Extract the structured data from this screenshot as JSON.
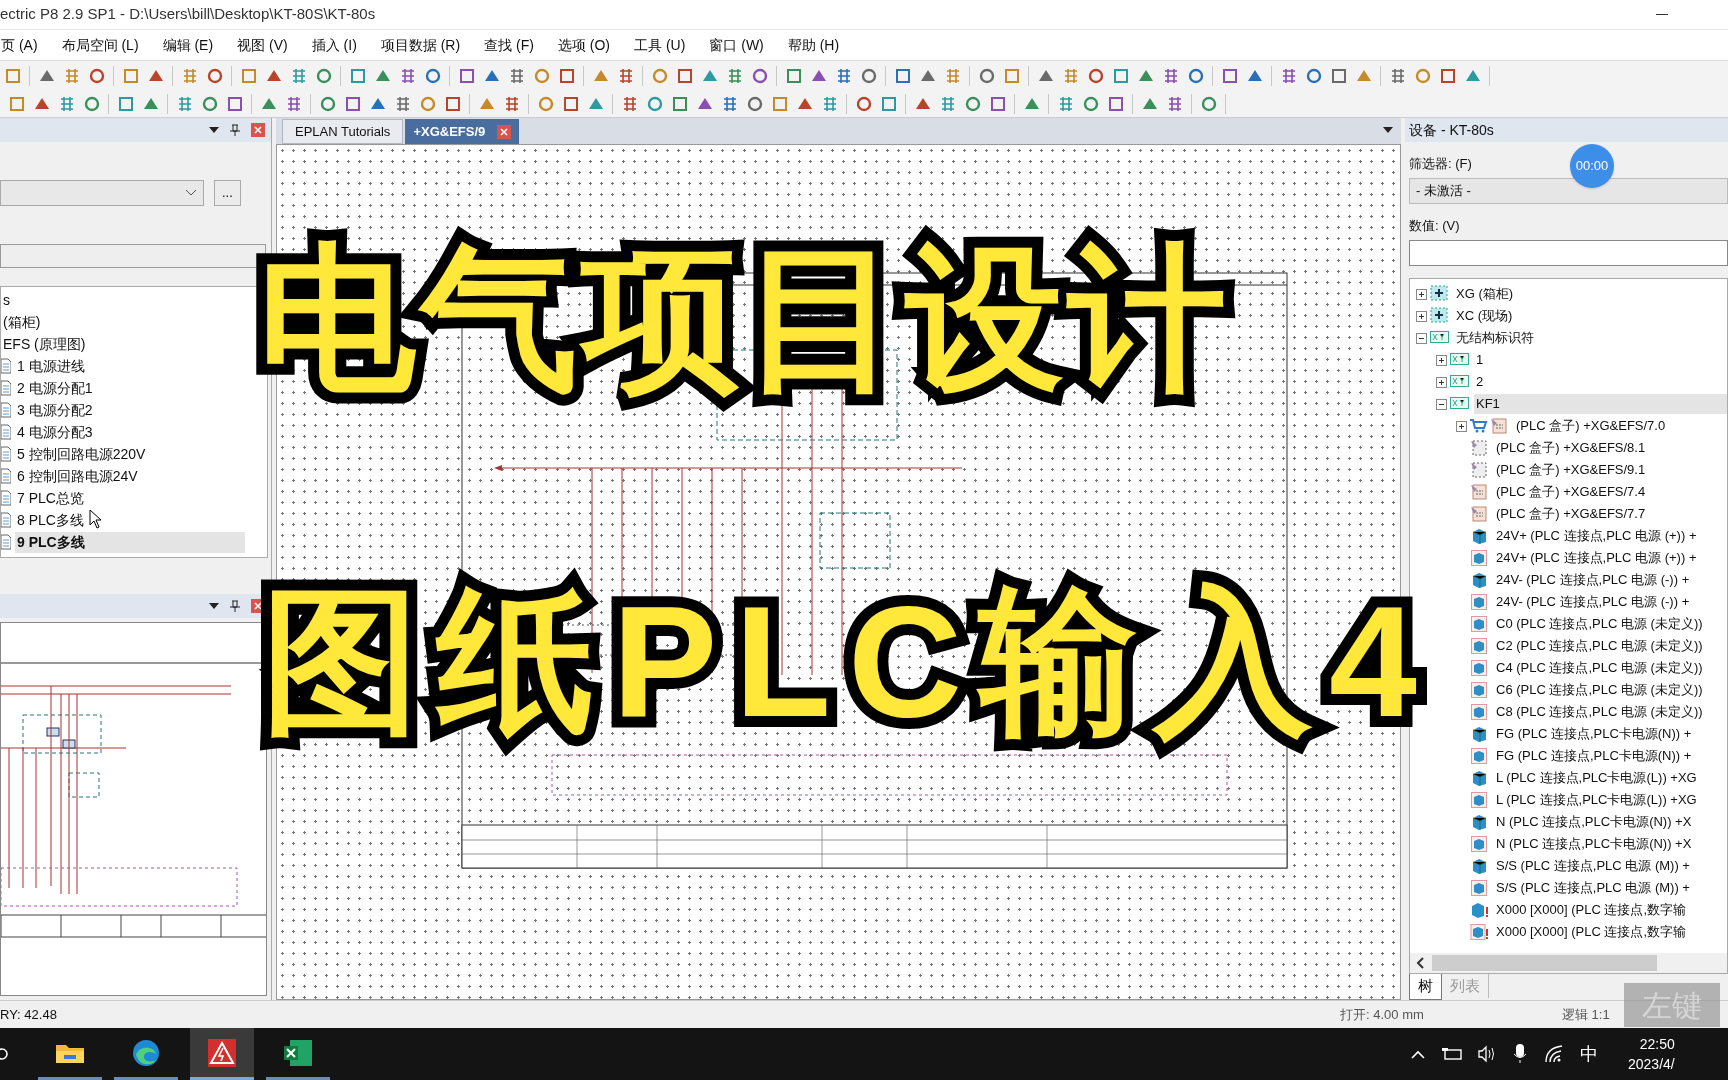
{
  "window": {
    "title": "ectric P8 2.9 SP1 - D:\\Users\\bill\\Desktop\\KT-80S\\KT-80s"
  },
  "menu": [
    "页 (A)",
    "布局空间 (L)",
    "编辑 (E)",
    "视图 (V)",
    "插入 (I)",
    "项目数据 (R)",
    "查找 (F)",
    "选项 (O)",
    "工具 (U)",
    "窗口 (W)",
    "帮助 (H)"
  ],
  "left_panel": {
    "browse_button": "...",
    "tree": [
      {
        "label": "s",
        "selected": false,
        "children": [
          {
            "label": "(箱柜)",
            "selected": false,
            "children": [
              {
                "label": "EFS (原理图)",
                "selected": false,
                "children": [
                  {
                    "label": "1 电源进线",
                    "selected": false
                  },
                  {
                    "label": "2 电源分配1",
                    "selected": false
                  },
                  {
                    "label": "3 电源分配2",
                    "selected": false
                  },
                  {
                    "label": "4 电源分配3",
                    "selected": false
                  },
                  {
                    "label": "5 控制回路电源220V",
                    "selected": false
                  },
                  {
                    "label": "6 控制回路电源24V",
                    "selected": false
                  },
                  {
                    "label": "7 PLC总览",
                    "selected": false
                  },
                  {
                    "label": "8 PLC多线",
                    "selected": false
                  },
                  {
                    "label": "9 PLC多线",
                    "selected": true
                  }
                ]
              }
            ]
          }
        ]
      }
    ]
  },
  "tabs": [
    {
      "label": "EPLAN Tutorials",
      "selected": false
    },
    {
      "label": "+XG&EFS/9",
      "selected": true
    }
  ],
  "overlay_title": [
    "电气项目设计",
    "图纸PLC输入4"
  ],
  "timer": "00:00",
  "right_panel": {
    "title": "设备 - KT-80s",
    "filter_label": "筛选器: (F)",
    "filter_value": "- 未激活 -",
    "value_label": "数值: (V)",
    "tree": [
      {
        "label": "XG (箱柜)",
        "kind": "location",
        "expanded": false,
        "selected": false
      },
      {
        "label": "XC (现场)",
        "kind": "location",
        "expanded": false,
        "selected": false
      },
      {
        "label": "无结构标识符",
        "kind": "xy",
        "expanded": true,
        "selected": false,
        "children": [
          {
            "label": "1",
            "kind": "xy",
            "expanded": false,
            "selected": false
          },
          {
            "label": "2",
            "kind": "xy",
            "expanded": false,
            "selected": false
          },
          {
            "label": "KF1",
            "kind": "xy",
            "expanded": true,
            "selected": true,
            "children": [
              {
                "label": "(PLC 盒子) +XG&EFS/7.0",
                "kind": "plc-box",
                "expanded": false,
                "selected": false
              },
              {
                "label": "(PLC 盒子) +XG&EFS/8.1",
                "kind": "plc-box-dashed",
                "selected": false
              },
              {
                "label": "(PLC 盒子) +XG&EFS/9.1",
                "kind": "plc-box-dashed",
                "selected": false
              },
              {
                "label": "(PLC 盒子) +XG&EFS/7.4",
                "kind": "plc-box",
                "selected": false
              },
              {
                "label": "(PLC 盒子) +XG&EFS/7.7",
                "kind": "plc-box",
                "selected": false
              },
              {
                "label": "24V+ (PLC 连接点,PLC 电源 (+)) +",
                "kind": "point",
                "selected": false
              },
              {
                "label": "24V+ (PLC 连接点,PLC 电源 (+)) +",
                "kind": "point-framed",
                "selected": false
              },
              {
                "label": "24V- (PLC 连接点,PLC 电源 (-)) +",
                "kind": "point",
                "selected": false
              },
              {
                "label": "24V- (PLC 连接点,PLC 电源 (-)) +",
                "kind": "point-framed",
                "selected": false
              },
              {
                "label": "C0 (PLC 连接点,PLC 电源 (未定义))",
                "kind": "point-framed",
                "selected": false
              },
              {
                "label": "C2 (PLC 连接点,PLC 电源 (未定义))",
                "kind": "point-framed",
                "selected": false
              },
              {
                "label": "C4 (PLC 连接点,PLC 电源 (未定义))",
                "kind": "point-framed",
                "selected": false
              },
              {
                "label": "C6 (PLC 连接点,PLC 电源 (未定义))",
                "kind": "point-framed",
                "selected": false
              },
              {
                "label": "C8 (PLC 连接点,PLC 电源 (未定义))",
                "kind": "point-framed",
                "selected": false
              },
              {
                "label": "FG (PLC 连接点,PLC卡电源(N)) +",
                "kind": "point",
                "selected": false
              },
              {
                "label": "FG (PLC 连接点,PLC卡电源(N)) +",
                "kind": "point-framed",
                "selected": false
              },
              {
                "label": "L (PLC 连接点,PLC卡电源(L)) +XG",
                "kind": "point",
                "selected": false
              },
              {
                "label": "L (PLC 连接点,PLC卡电源(L)) +XG",
                "kind": "point-framed",
                "selected": false
              },
              {
                "label": "N (PLC 连接点,PLC卡电源(N)) +X",
                "kind": "point",
                "selected": false
              },
              {
                "label": "N (PLC 连接点,PLC卡电源(N)) +X",
                "kind": "point-framed",
                "selected": false
              },
              {
                "label": "S/S (PLC 连接点,PLC 电源 (M)) +",
                "kind": "point",
                "selected": false
              },
              {
                "label": "S/S (PLC 连接点,PLC 电源 (M)) +",
                "kind": "point-framed",
                "selected": false
              },
              {
                "label": "X000  [X000] (PLC 连接点,数字输",
                "kind": "point-warning",
                "selected": false
              },
              {
                "label": "X000  [X000] (PLC 连接点,数字输",
                "kind": "point-framed-warning",
                "selected": false
              }
            ]
          }
        ]
      }
    ],
    "tabs": [
      {
        "label": "树",
        "selected": true
      },
      {
        "label": "列表",
        "selected": false
      }
    ]
  },
  "status_bar": {
    "coords": "RY: 42.48",
    "open": "打开: 4.00 mm",
    "logic": "逻辑 1:1"
  },
  "key_indicator": "左键",
  "taskbar": {
    "apps": [
      {
        "kind": "folder",
        "active": false
      },
      {
        "kind": "browser",
        "active": false
      },
      {
        "kind": "eplan",
        "active": true
      },
      {
        "kind": "excel",
        "active": false
      }
    ],
    "ime": "中",
    "time": "22:50",
    "date": "2023/4/"
  }
}
